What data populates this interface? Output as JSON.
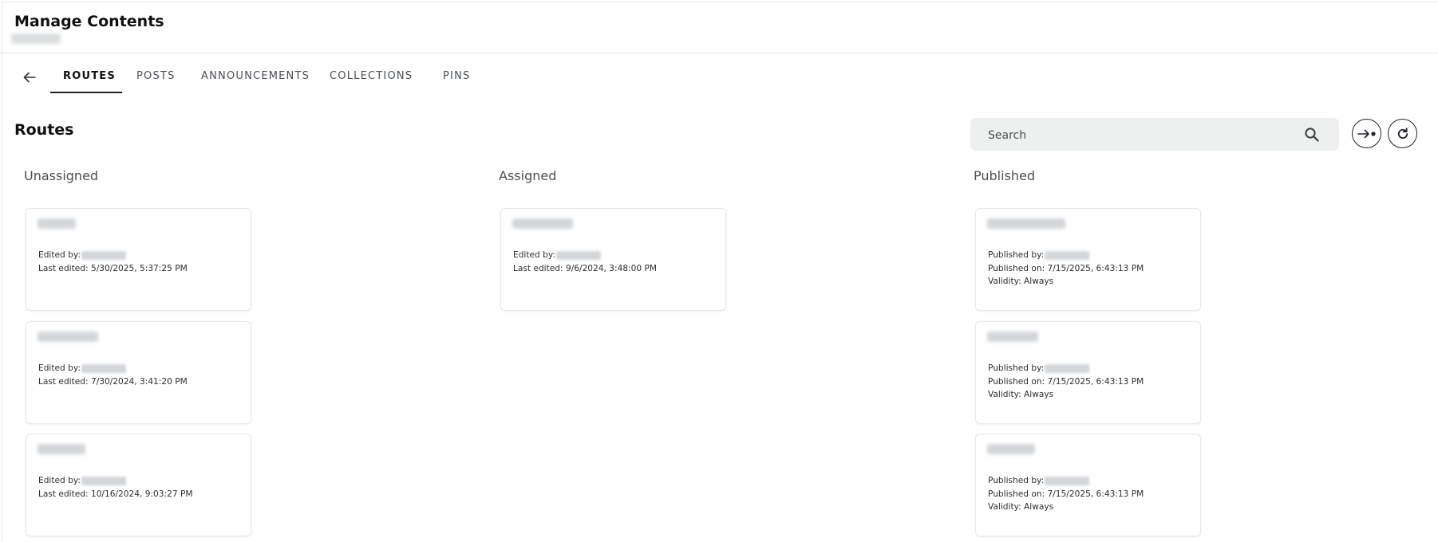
{
  "header": {
    "title": "Manage Contents"
  },
  "tabs": [
    {
      "label": "ROUTES",
      "active": true
    },
    {
      "label": "POSTS",
      "active": false
    },
    {
      "label": "ANNOUNCEMENTS",
      "active": false
    },
    {
      "label": "COLLECTIONS",
      "active": false
    },
    {
      "label": "PINS",
      "active": false
    }
  ],
  "section": {
    "title": "Routes"
  },
  "search": {
    "placeholder": "Search",
    "value": ""
  },
  "columns": {
    "unassigned": {
      "title": "Unassigned",
      "cards": [
        {
          "edited_label": "Edited by:",
          "last_edited": "Last edited: 5/30/2025, 5:37:25 PM"
        },
        {
          "edited_label": "Edited by:",
          "last_edited": "Last edited: 7/30/2024, 3:41:20 PM"
        },
        {
          "edited_label": "Edited by:",
          "last_edited": "Last edited: 10/16/2024, 9:03:27 PM"
        }
      ]
    },
    "assigned": {
      "title": "Assigned",
      "cards": [
        {
          "edited_label": "Edited by:",
          "last_edited": "Last edited: 9/6/2024, 3:48:00 PM"
        }
      ]
    },
    "published": {
      "title": "Published",
      "cards": [
        {
          "published_label": "Published by:",
          "published_on": "Published on: 7/15/2025, 6:43:13 PM",
          "validity": "Validity: Always"
        },
        {
          "published_label": "Published by:",
          "published_on": "Published on: 7/15/2025, 6:43:13 PM",
          "validity": "Validity: Always"
        },
        {
          "published_label": "Published by:",
          "published_on": "Published on: 7/15/2025, 6:43:13 PM",
          "validity": "Validity: Always"
        }
      ]
    }
  },
  "icons": {
    "back": "arrow-left-icon",
    "search": "search-icon",
    "export": "arrow-right-dot-icon",
    "refresh": "refresh-icon"
  },
  "colors": {
    "accent": "#1f2328",
    "search_bg": "#eef0f0",
    "muted": "#4b4f54"
  }
}
